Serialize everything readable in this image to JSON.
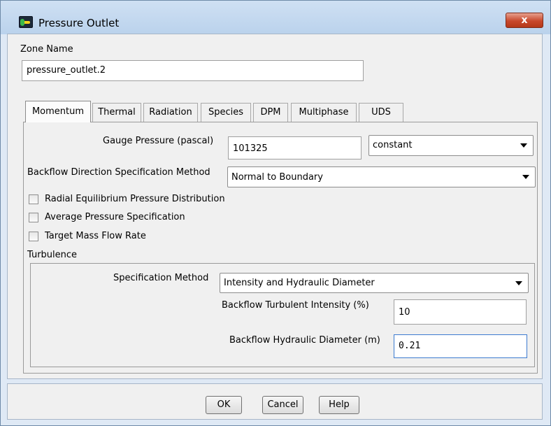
{
  "window": {
    "title": "Pressure Outlet",
    "close_glyph": "x"
  },
  "zone": {
    "label": "Zone Name",
    "value": "pressure_outlet.2"
  },
  "tabs": [
    "Momentum",
    "Thermal",
    "Radiation",
    "Species",
    "DPM",
    "Multiphase",
    "UDS"
  ],
  "active_tab": "Momentum",
  "momentum": {
    "gauge_pressure_label": "Gauge Pressure (pascal)",
    "gauge_pressure_value": "101325",
    "gauge_pressure_profile": "constant",
    "backflow_direction_label": "Backflow Direction Specification Method",
    "backflow_direction_value": "Normal to Boundary",
    "checkboxes": [
      {
        "label": "Radial Equilibrium Pressure Distribution",
        "checked": false
      },
      {
        "label": "Average Pressure Specification",
        "checked": false
      },
      {
        "label": "Target Mass Flow Rate",
        "checked": false
      }
    ]
  },
  "turbulence": {
    "group_label": "Turbulence",
    "spec_method_label": "Specification Method",
    "spec_method_value": "Intensity and Hydraulic Diameter",
    "intensity_label": "Backflow Turbulent Intensity (%)",
    "intensity_value": "10",
    "diameter_label": "Backflow Hydraulic Diameter (m)",
    "diameter_value": "0.21"
  },
  "buttons": {
    "ok": "OK",
    "cancel": "Cancel",
    "help": "Help"
  },
  "icons": {
    "app": "fluent-app-icon",
    "close": "close-icon",
    "dropdown": "chevron-down-icon"
  },
  "colors": {
    "close_button": "#c8482c",
    "title_bar": "#c4d9ef",
    "panel": "#f0f0f0"
  }
}
